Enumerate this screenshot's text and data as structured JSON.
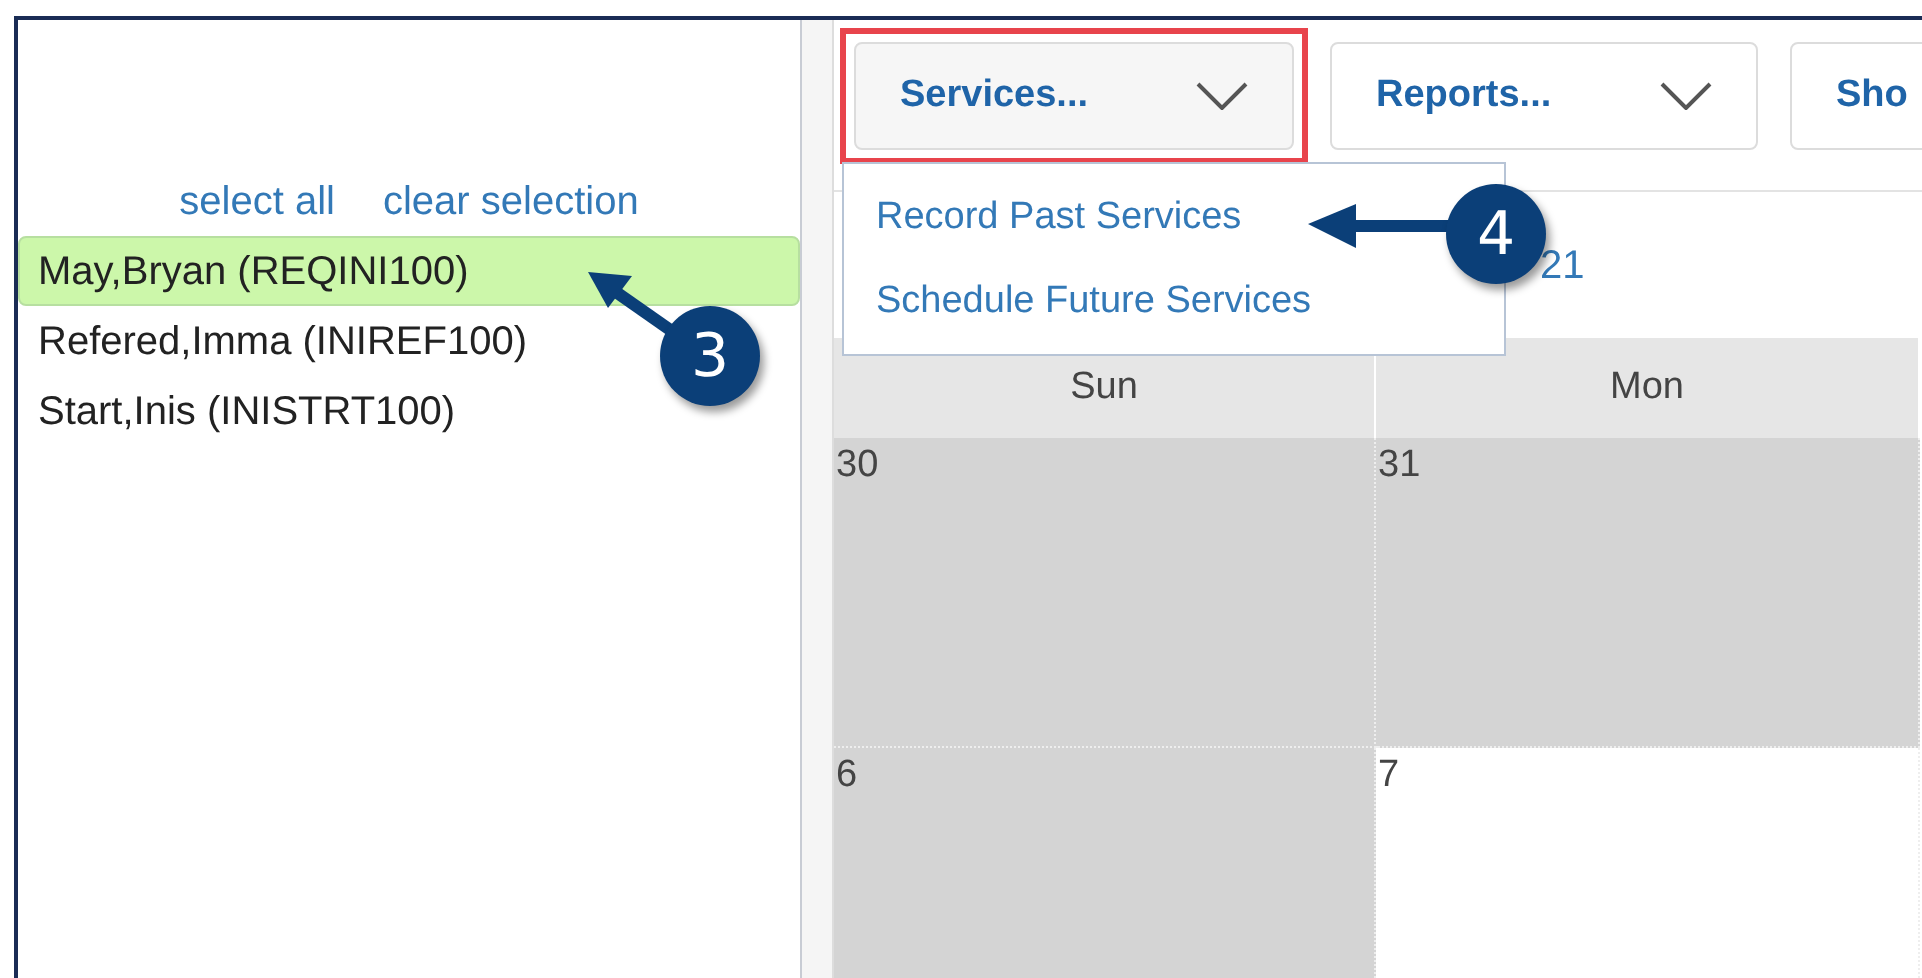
{
  "selection_links": [
    {
      "label": "select all"
    },
    {
      "label": "clear selection"
    }
  ],
  "people": [
    {
      "label": "May,Bryan (REQINI100)",
      "selected": true
    },
    {
      "label": "Refered,Imma (INIREF100)",
      "selected": false
    },
    {
      "label": "Start,Inis (INISTRT100)",
      "selected": false
    }
  ],
  "toolbar": [
    {
      "label": "Services...",
      "highlighted": true,
      "has_caret": true
    },
    {
      "label": "Reports...",
      "highlighted": false,
      "has_caret": true
    },
    {
      "label": "Sho",
      "highlighted": false
    }
  ],
  "services_menu": [
    {
      "label": "Record Past Services"
    },
    {
      "label": "Schedule Future Services"
    }
  ],
  "calendar": {
    "title_fragment": "21",
    "weekdays": [
      "Sun",
      "Mon"
    ],
    "weeks": [
      [
        {
          "day": "30",
          "shaded": true
        },
        {
          "day": "31",
          "shaded": true
        }
      ],
      [
        {
          "day": "6",
          "shaded": true
        },
        {
          "day": "7",
          "shaded": false
        }
      ]
    ]
  },
  "callouts": [
    {
      "number": "3"
    },
    {
      "number": "4"
    }
  ]
}
